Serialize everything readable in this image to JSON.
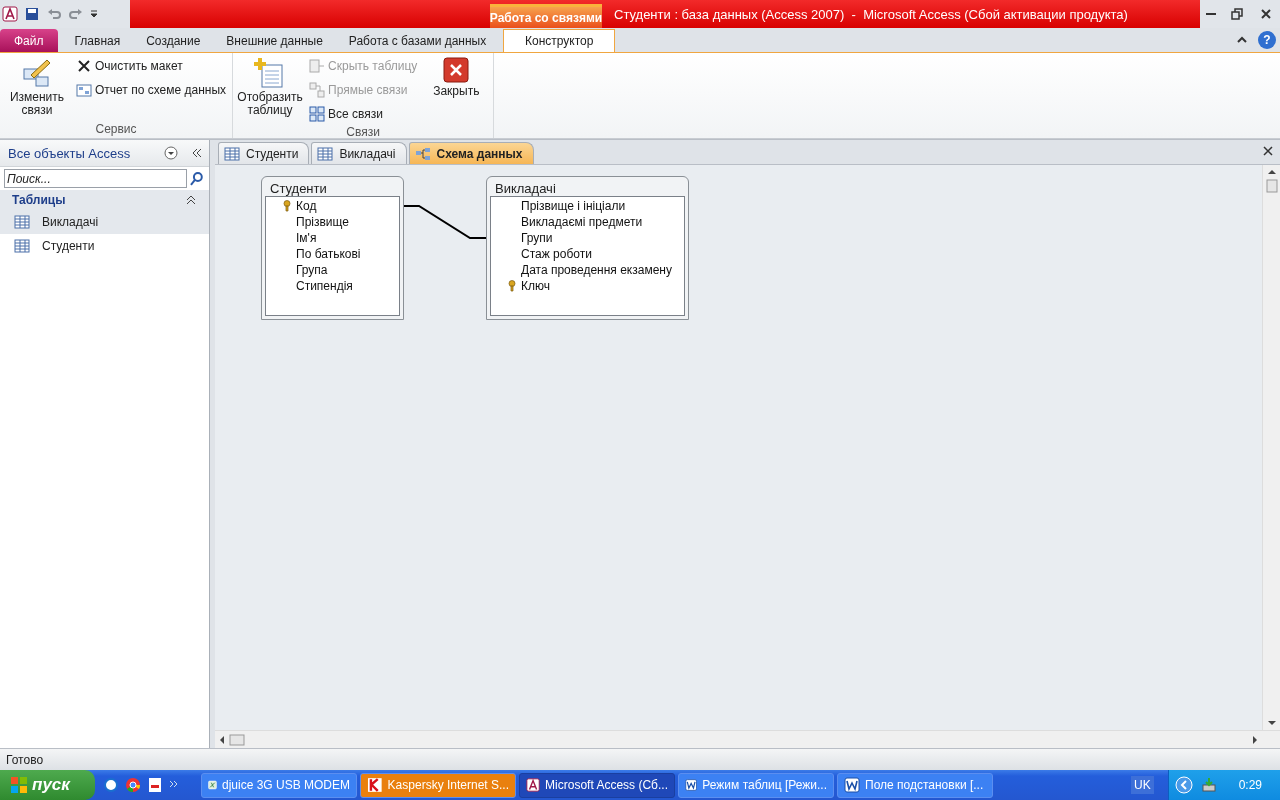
{
  "window": {
    "title": "Студенти : база данных (Access 2007)  -  Microsoft Access (Сбой активации продукта)",
    "context_group": "Работа со связями",
    "help": "?"
  },
  "ribbon": {
    "tabs": [
      {
        "label": "Файл",
        "kind": "file",
        "selected": false
      },
      {
        "label": "Главная",
        "kind": "normal",
        "selected": false
      },
      {
        "label": "Создание",
        "kind": "normal",
        "selected": false
      },
      {
        "label": "Внешние данные",
        "kind": "normal",
        "selected": false
      },
      {
        "label": "Работа с базами данных",
        "kind": "normal",
        "selected": false
      },
      {
        "label": "Конструктор",
        "kind": "context",
        "selected": true
      }
    ],
    "groups": [
      {
        "label": "Сервис",
        "buttons": [
          {
            "label": "Изменить связи",
            "kind": "edit",
            "disabled": false
          },
          {
            "label": "Очистить макет",
            "kind": "clear",
            "disabled": false
          },
          {
            "label": "Отчет по схеме данных",
            "kind": "report",
            "disabled": false
          }
        ]
      },
      {
        "label": "Связи",
        "buttons": [
          {
            "label": "Отобразить таблицу",
            "kind": "add-table",
            "disabled": false
          },
          {
            "label": "Скрыть таблицу",
            "kind": "hide",
            "disabled": true
          },
          {
            "label": "Прямые связи",
            "kind": "direct",
            "disabled": true
          },
          {
            "label": "Все связи",
            "kind": "all",
            "disabled": false
          },
          {
            "label": "Закрыть",
            "kind": "close",
            "disabled": false
          }
        ]
      }
    ]
  },
  "nav_pane": {
    "title": "Все объекты Access",
    "search": {
      "placeholder": "Поиск..."
    },
    "group": {
      "label": "Таблицы",
      "expanded": true
    },
    "items": [
      {
        "label": "Викладачі",
        "selected": true
      },
      {
        "label": "Студенти",
        "selected": false
      }
    ]
  },
  "doc_tabs": [
    {
      "label": "Студенти",
      "kind": "table",
      "selected": false
    },
    {
      "label": "Викладачі",
      "kind": "table",
      "selected": false
    },
    {
      "label": "Схема данных",
      "kind": "diagram",
      "selected": true
    }
  ],
  "diagram": {
    "tables": [
      {
        "title": "Студенти",
        "fields": [
          {
            "name": "Код",
            "primary_key": true
          },
          {
            "name": "Прізвище",
            "primary_key": false
          },
          {
            "name": "Ім'я",
            "primary_key": false
          },
          {
            "name": "По батькові",
            "primary_key": false
          },
          {
            "name": "Група",
            "primary_key": false
          },
          {
            "name": "Стипендія",
            "primary_key": false
          }
        ]
      },
      {
        "title": "Викладачі",
        "fields": [
          {
            "name": "Прізвище і ініціали",
            "primary_key": false
          },
          {
            "name": "Викладаємі предмети",
            "primary_key": false
          },
          {
            "name": "Групи",
            "primary_key": false
          },
          {
            "name": "Стаж роботи",
            "primary_key": false
          },
          {
            "name": "Дата проведення екзамену",
            "primary_key": false
          },
          {
            "name": "Ключ",
            "primary_key": true
          }
        ]
      }
    ]
  },
  "status_bar": {
    "text": "Готово"
  },
  "taskbar": {
    "start": "пуск",
    "tasks": [
      {
        "label": "djuice 3G USB MODEM",
        "kind": "modem",
        "selected": false,
        "flashing": false
      },
      {
        "label": "Kaspersky Internet S...",
        "kind": "kaspersky",
        "selected": false,
        "flashing": true
      },
      {
        "label": "Microsoft Access (Сб...",
        "kind": "access",
        "selected": true,
        "flashing": false
      },
      {
        "label": "Режим таблиц [Режи...",
        "kind": "word",
        "selected": false,
        "flashing": false
      },
      {
        "label": "Поле подстановки [...",
        "kind": "word",
        "selected": false,
        "flashing": false
      }
    ],
    "language": "UK",
    "clock": "0:29"
  }
}
